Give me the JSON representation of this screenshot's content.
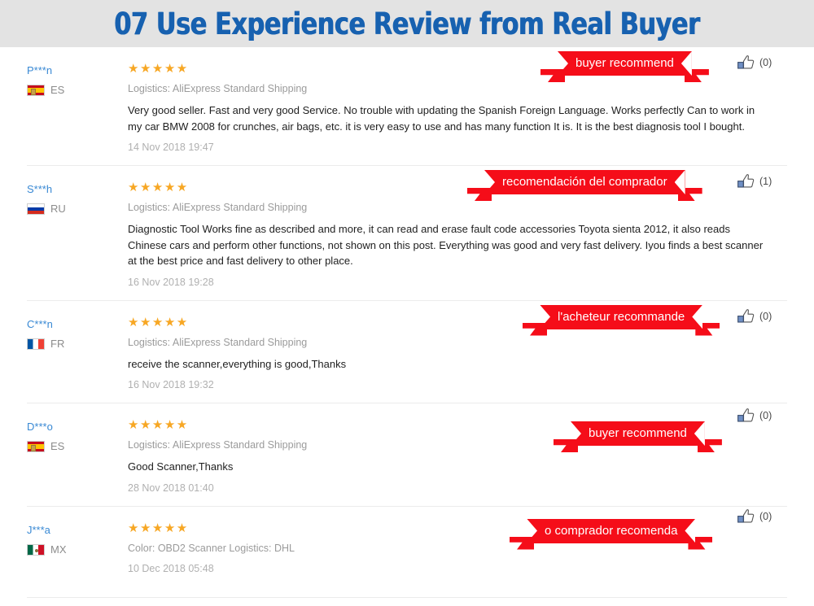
{
  "header": {
    "title": "07 Use Experience Review from Real Buyer",
    "band_color": "#e3e3e3",
    "title_color": "#1761b0"
  },
  "labels": {
    "stars_five": "★★★★★",
    "thumb_icon": "thumbs-up-icon"
  },
  "reviews": [
    {
      "user": "P***n",
      "country_code": "ES",
      "flag": "flag-es",
      "stars": "★★★★★",
      "meta": "Logistics: AliExpress Standard Shipping",
      "text": "Very good seller. Fast and very good Service. No trouble with updating the Spanish Foreign Language. Works perfectly Can to work in my car BMW 2008 for crunches, air bags, etc. it is very easy to use and has many function It is. It is the best diagnosis tool I bought.",
      "date": "14 Nov 2018 19:47",
      "ribbon": "buyer recommend",
      "thumb_count": "(0)"
    },
    {
      "user": "S***h",
      "country_code": "RU",
      "flag": "flag-ru",
      "stars": "★★★★★",
      "meta": "Logistics: AliExpress Standard Shipping",
      "text": "Diagnostic Tool Works fine as described and more, it can read and erase fault code accessories Toyota sienta 2012, it also reads Chinese cars and perform other functions, not shown on this post. Everything was good and very fast delivery. Iyou finds a best scanner at the best price and fast delivery to other place.",
      "date": "16 Nov 2018 19:28",
      "ribbon": "recomendación del comprador",
      "thumb_count": "(1)"
    },
    {
      "user": "C***n",
      "country_code": "FR",
      "flag": "flag-fr",
      "stars": "★★★★★",
      "meta": "Logistics: AliExpress Standard Shipping",
      "text": "receive the scanner,everything is good,Thanks",
      "date": "16 Nov 2018 19:32",
      "ribbon": "l'acheteur recommande",
      "thumb_count": "(0)"
    },
    {
      "user": "D***o",
      "country_code": "ES",
      "flag": "flag-es",
      "stars": "★★★★★",
      "meta": "Logistics: AliExpress Standard Shipping",
      "text": "Good Scanner,Thanks",
      "date": "28 Nov 2018 01:40",
      "ribbon": "buyer recommend",
      "thumb_count": "(0)"
    },
    {
      "user": "J***a",
      "country_code": "MX",
      "flag": "flag-mx",
      "stars": "★★★★★",
      "meta": "Color: OBD2 Scanner    Logistics: DHL",
      "text": "",
      "date": "10 Dec 2018 05:48",
      "ribbon": "o comprador recomenda",
      "thumb_count": "(0)"
    }
  ]
}
